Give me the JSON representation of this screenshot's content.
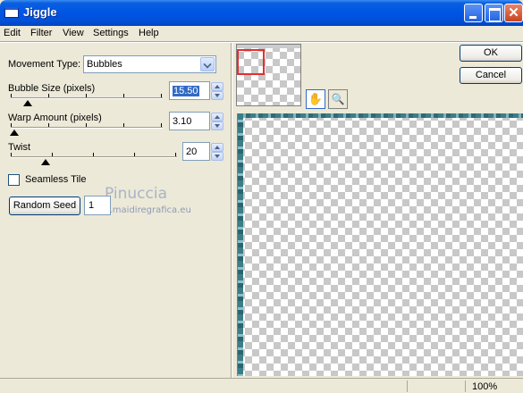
{
  "window": {
    "title": "Jiggle"
  },
  "menu": [
    "Edit",
    "Filter",
    "View",
    "Settings",
    "Help"
  ],
  "controls": {
    "movement_type": {
      "label": "Movement Type:",
      "value": "Bubbles"
    },
    "bubble_size": {
      "label": "Bubble Size (pixels)",
      "value": "15.50"
    },
    "warp_amount": {
      "label": "Warp Amount (pixels)",
      "value": "3.10"
    },
    "twist": {
      "label": "Twist",
      "value": "20"
    },
    "seamless_tile": {
      "label": "Seamless Tile",
      "checked": false
    },
    "random_seed": {
      "label": "Random Seed",
      "value": "1"
    }
  },
  "watermark": {
    "line1": "Pinuccia",
    "line2": "www.maidiregrafica.eu"
  },
  "buttons": {
    "ok": "OK",
    "cancel": "Cancel"
  },
  "tools": {
    "hand": "✋",
    "zoom": "🔍"
  },
  "status": {
    "zoom": "100%"
  },
  "colors": {
    "title_bar": "#0055E5",
    "frame": "#3b7e8a",
    "nav_rect": "#E03030",
    "selection": "#316AC5"
  }
}
